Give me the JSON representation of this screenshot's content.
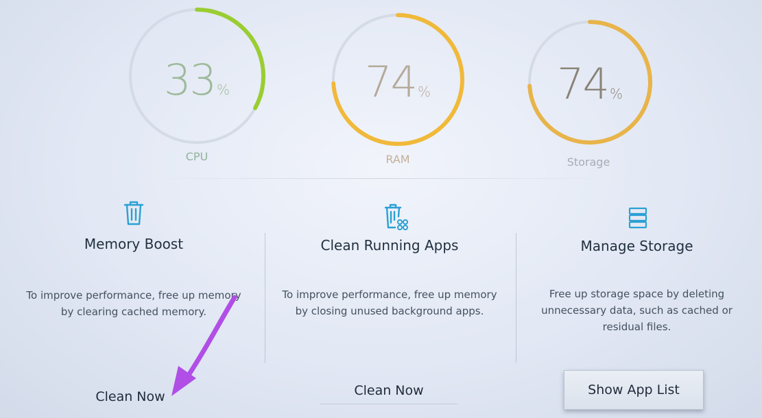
{
  "gauges": [
    {
      "value": "33",
      "unit": "%",
      "label": "CPU",
      "level": 0.33,
      "color": "#9acd32",
      "text_color": "#9dba9a",
      "label_color": "#8fb49a"
    },
    {
      "value": "74",
      "unit": "%",
      "label": "RAM",
      "level": 0.74,
      "color": "#f0b93a",
      "text_color": "#b5a99a",
      "label_color": "#c4b098"
    },
    {
      "value": "74",
      "unit": "%",
      "label": "Storage",
      "level": 0.74,
      "color": "#e8b44a",
      "text_color": "#8a8478",
      "label_color": "#a9abb2"
    }
  ],
  "cards": [
    {
      "icon": "trash-icon",
      "title": "Memory Boost",
      "description": [
        "To improve performance, free up memory",
        "by clearing cached memory."
      ],
      "button": "Clean Now"
    },
    {
      "icon": "trash-apps-icon",
      "title": "Clean Running Apps",
      "description": [
        "To improve performance, free up memory",
        "by closing unused background apps."
      ],
      "button": "Clean Now"
    },
    {
      "icon": "storage-icon",
      "title": "Manage Storage",
      "description": [
        "Free up storage space by deleting",
        "unnecessary data, such as cached or",
        "residual files."
      ],
      "button": "Show App List"
    }
  ],
  "colors": {
    "icon": "#2aa0d4",
    "track": "#d4dbe6",
    "arrow": "#b04ee6"
  }
}
